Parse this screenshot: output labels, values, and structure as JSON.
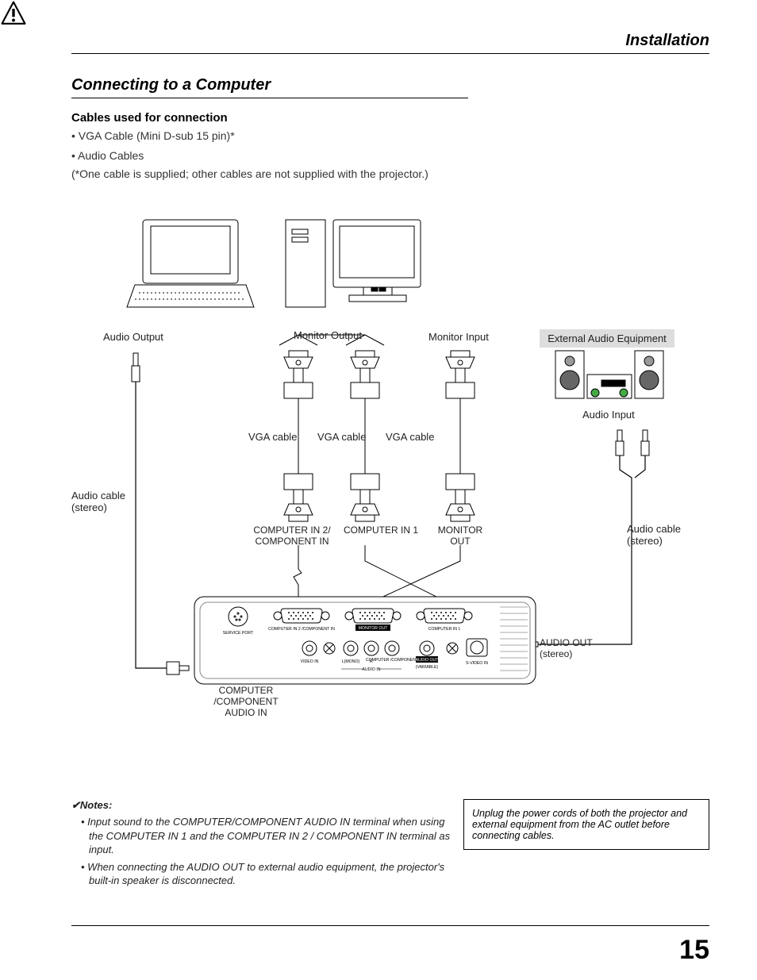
{
  "header": {
    "section": "Installation"
  },
  "title": "Connecting to a Computer",
  "cables": {
    "heading": "Cables used for connection",
    "items": [
      "VGA Cable (Mini D-sub 15 pin)*",
      "Audio Cables"
    ],
    "footnote": "(*One cable is supplied; other cables are not supplied with the projector.)"
  },
  "labels": {
    "audio_output": "Audio Output",
    "monitor_output": "Monitor Output",
    "monitor_input": "Monitor Input",
    "external_audio": "External Audio Equipment",
    "audio_input": "Audio Input",
    "vga_cable": "VGA cable",
    "audio_cable_stereo": "Audio cable (stereo)",
    "computer_in_2": "COMPUTER IN 2/ COMPONENT IN",
    "computer_in_1": "COMPUTER IN 1",
    "monitor_out": "MONITOR OUT",
    "computer_component_audio_in": "COMPUTER /COMPONENT AUDIO IN",
    "audio_out_stereo": "AUDIO OUT (stereo)"
  },
  "panel": {
    "service_port": "SERVICE PORT",
    "computer_in2_component": "COMPUTER IN 2 /COMPONENT IN",
    "monitor_out": "MONITOR OUT",
    "computer_in1": "COMPUTER IN 1",
    "video_in": "VIDEO IN",
    "l_mono": "L(MONO)",
    "r": "R",
    "computer_component": "COMPUTER /COMPONENT",
    "audio_out": "AUDIO OUT",
    "variable": "(VARIABLE)",
    "s_video_in": "S-VIDEO IN",
    "audio_in": "AUDIO IN"
  },
  "notes": {
    "heading": "✔Notes:",
    "items": [
      "Input sound to the COMPUTER/COMPONENT AUDIO IN terminal when using the COMPUTER IN 1 and the COMPUTER IN 2 / COMPONENT IN terminal as input.",
      "When connecting the AUDIO OUT to external audio equipment, the projector's built-in speaker is disconnected."
    ]
  },
  "warning": "Unplug the power cords of both the projector and external equipment from the AC outlet before connecting cables.",
  "page": "15"
}
